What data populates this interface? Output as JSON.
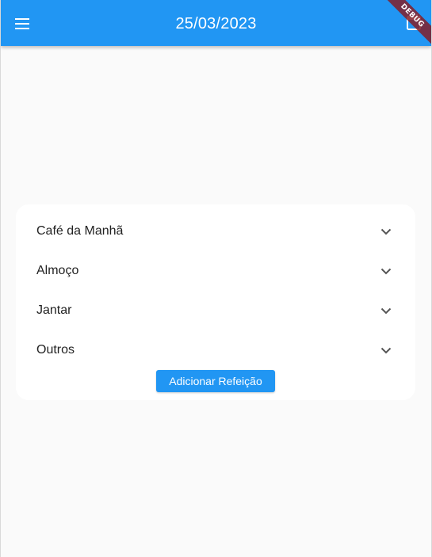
{
  "appbar": {
    "title": "25/03/2023",
    "menu_icon": "menu-icon",
    "action_icon": "calendar-icon",
    "color": "#2196f3"
  },
  "debug_banner": {
    "label": "DEBUG"
  },
  "meals": {
    "items": [
      {
        "label": "Café da Manhã",
        "icon": "chevron-down-icon"
      },
      {
        "label": "Almoço",
        "icon": "chevron-down-icon"
      },
      {
        "label": "Jantar",
        "icon": "chevron-down-icon"
      },
      {
        "label": "Outros",
        "icon": "chevron-down-icon"
      }
    ],
    "add_button_label": "Adicionar Refeição"
  }
}
